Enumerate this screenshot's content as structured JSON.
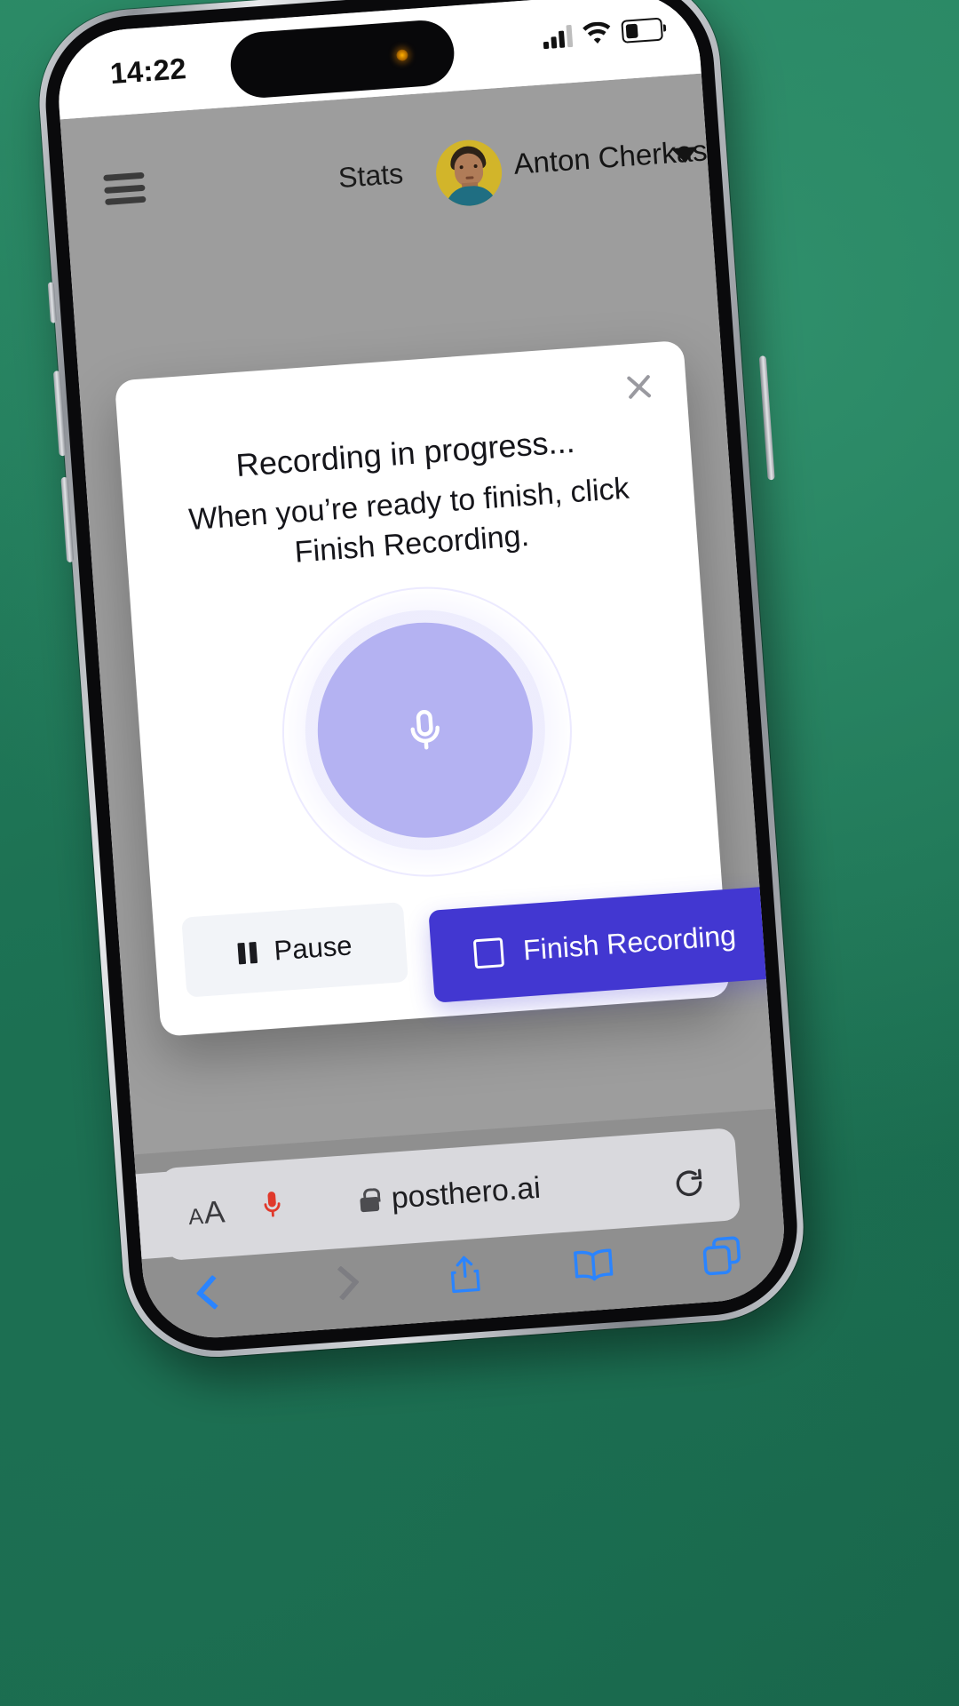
{
  "status_bar": {
    "time": "14:22",
    "signal_icon": "cellular-bars-icon",
    "wifi_icon": "wifi-icon",
    "battery_icon": "battery-low-icon",
    "camera_icon": "front-camera-dot-icon"
  },
  "page_header": {
    "menu_icon": "hamburger-menu-icon",
    "nav_label": "Stats",
    "avatar_icon": "user-avatar",
    "user_name": "Anton Cherkasov",
    "chevron_icon": "chevron-down-icon"
  },
  "modal": {
    "close_icon": "close-icon",
    "title": "Recording in progress...",
    "subtitle": "When you’re ready to finish, click Finish Recording.",
    "mic_icon": "microphone-icon",
    "pause_label": "Pause",
    "pause_icon": "pause-icon",
    "finish_label": "Finish Recording",
    "finish_icon": "stop-square-icon"
  },
  "browser": {
    "text_size_small": "A",
    "text_size_large": "A",
    "mic_permission_icon": "microphone-active-icon",
    "lock_icon": "lock-icon",
    "url": "posthero.ai",
    "reload_icon": "reload-icon",
    "back_icon": "chevron-left-icon",
    "forward_icon": "chevron-right-icon",
    "share_icon": "share-icon",
    "bookmarks_icon": "book-icon",
    "tabs_icon": "tabs-icon"
  },
  "colors": {
    "accent_indigo": "#4237d1",
    "mic_purple": "#b4b2f2",
    "page_overlay_gray": "#9d9d9d",
    "safari_chrome": "#8f8f8f",
    "link_blue": "#2a84ff",
    "backdrop_green": "#1d7354"
  }
}
